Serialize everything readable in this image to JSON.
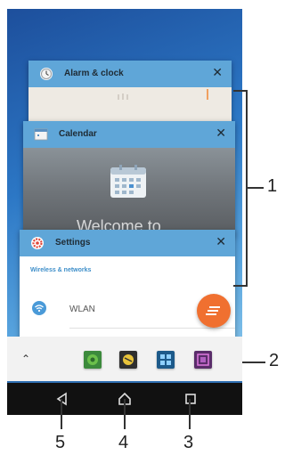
{
  "recent_apps": [
    {
      "title": "Alarm & clock",
      "close_icon": "close-icon"
    },
    {
      "title": "Calendar",
      "close_icon": "close-icon",
      "body_text": "Welcome to"
    },
    {
      "title": "Settings",
      "close_icon": "close-icon",
      "section_header": "Wireless & networks",
      "first_item": "WLAN"
    }
  ],
  "close_glyph": "✕",
  "recent_bar": {
    "chevron": "⌃"
  },
  "callouts": [
    "1",
    "2",
    "3",
    "4",
    "5"
  ],
  "colors": {
    "card_header": "#5fa6d8",
    "fab": "#f07030",
    "section_header": "#3d8ec9",
    "navbar": "#111111"
  }
}
